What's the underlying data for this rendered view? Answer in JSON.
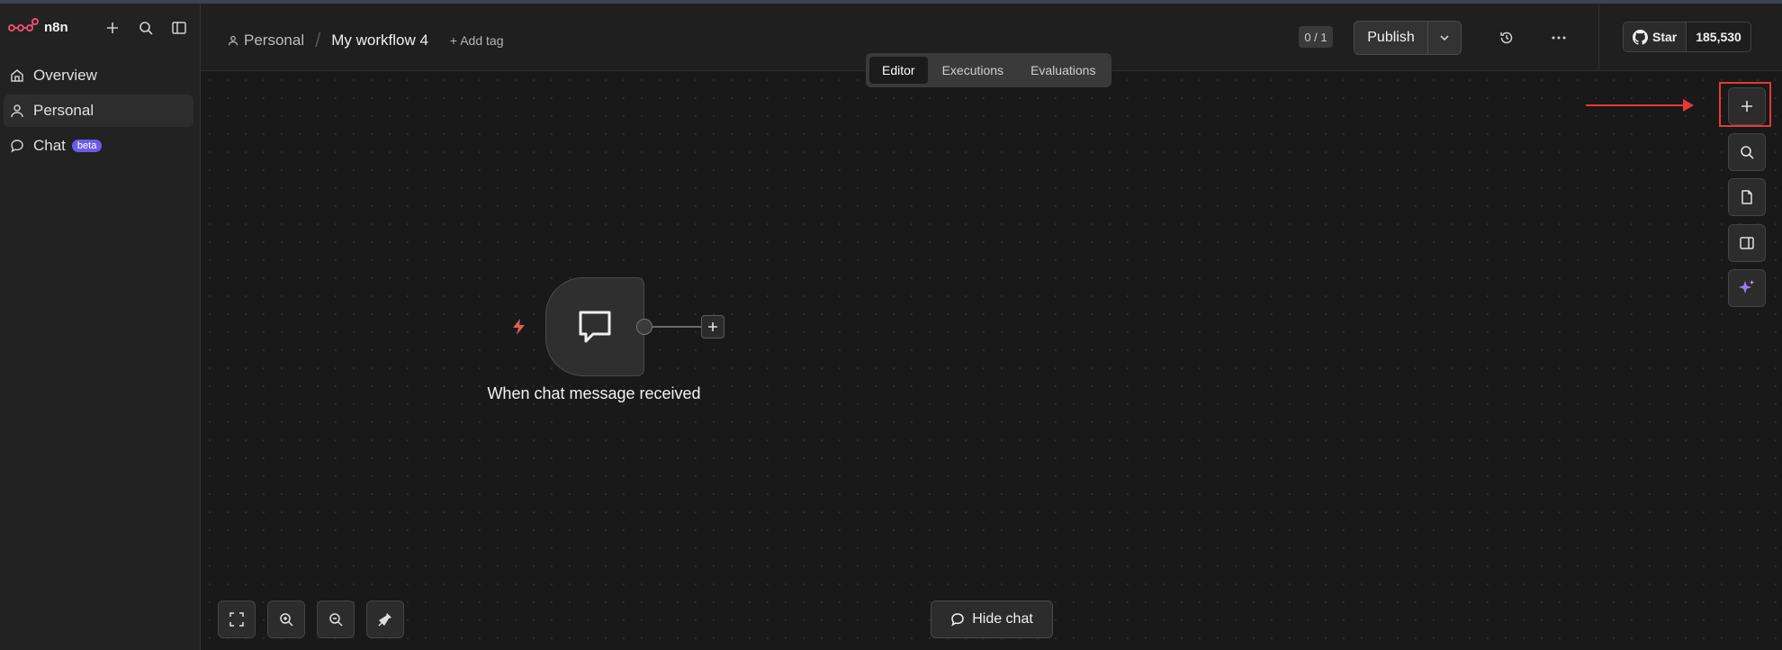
{
  "app": {
    "name": "n8n",
    "brand_color": "#ea4b71"
  },
  "sidebar": {
    "actions": [
      {
        "icon": "plus-icon"
      },
      {
        "icon": "search-icon"
      },
      {
        "icon": "sidebar-toggle-icon"
      }
    ],
    "items": [
      {
        "label": "Overview",
        "icon": "home-icon"
      },
      {
        "label": "Personal",
        "icon": "user-icon",
        "active": true
      },
      {
        "label": "Chat",
        "icon": "chat-bubble-icon",
        "badge": "beta"
      }
    ]
  },
  "header": {
    "project": "Personal",
    "workflow_title": "My workflow 4",
    "add_tag": "+ Add tag",
    "counter": "0 / 1",
    "publish_label": "Publish",
    "github": {
      "star_label": "Star",
      "count": "185,530"
    }
  },
  "tabs": [
    {
      "label": "Editor",
      "active": true
    },
    {
      "label": "Executions"
    },
    {
      "label": "Evaluations"
    }
  ],
  "canvas": {
    "node": {
      "label": "When chat message received",
      "icon": "chat-bubble-icon",
      "trigger_icon": "lightning-icon"
    }
  },
  "right_toolbar": [
    {
      "icon": "plus-icon",
      "highlighted": true
    },
    {
      "icon": "search-icon"
    },
    {
      "icon": "sticky-note-icon"
    },
    {
      "icon": "panel-icon"
    },
    {
      "icon": "ai-sparkle-icon"
    }
  ],
  "bottom_controls": [
    {
      "icon": "fit-view-icon"
    },
    {
      "icon": "zoom-in-icon"
    },
    {
      "icon": "zoom-out-icon"
    },
    {
      "icon": "tidy-up-icon"
    }
  ],
  "hide_chat_label": "Hide chat",
  "annotation_color": "#e53935"
}
